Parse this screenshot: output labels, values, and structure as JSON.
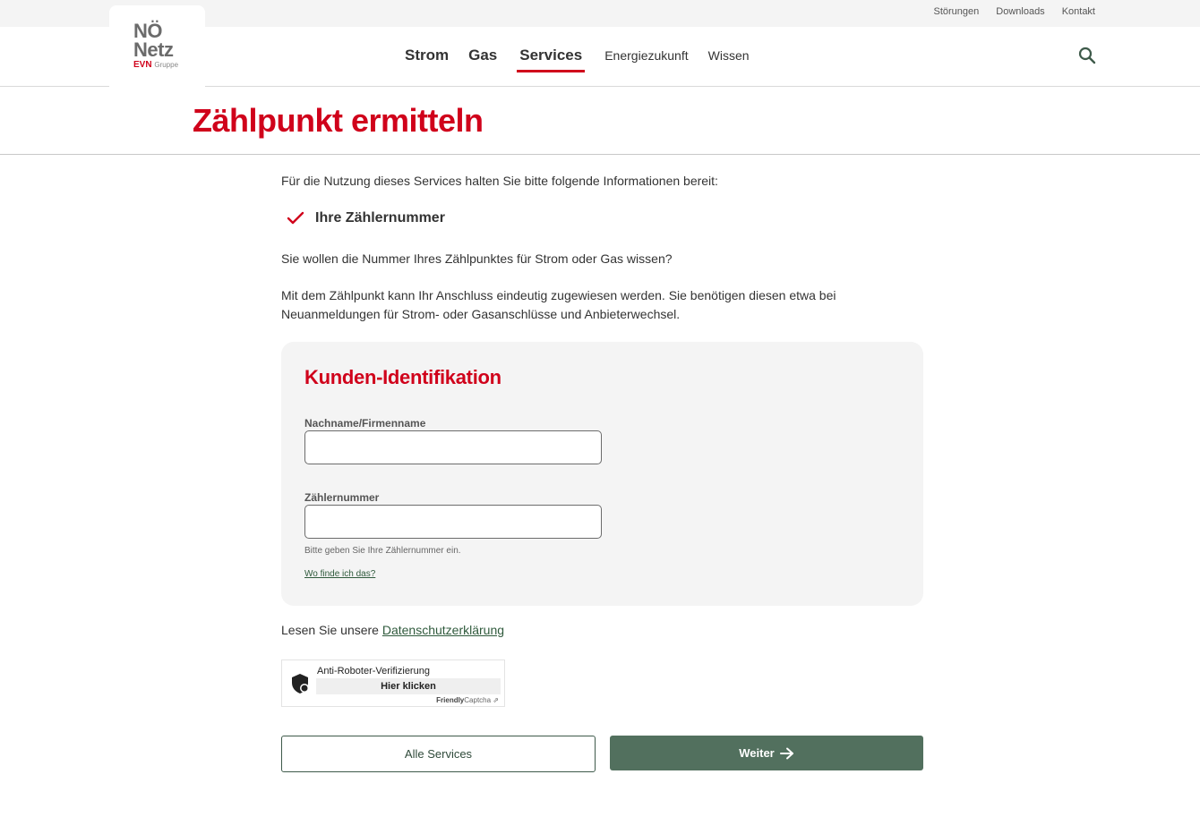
{
  "utility_links": [
    "Störungen",
    "Downloads",
    "Kontakt"
  ],
  "logo": {
    "line1": "NÖ",
    "line2": "Netz",
    "evn": "EVN",
    "gruppe": "Gruppe"
  },
  "nav": {
    "main": [
      "Strom",
      "Gas",
      "Services"
    ],
    "active": "Services",
    "sub": [
      "Energiezukunft",
      "Wissen"
    ]
  },
  "page_title": "Zählpunkt ermitteln",
  "intro": "Für die Nutzung dieses Services halten Sie bitte folgende Informationen bereit:",
  "requirement": "Ihre Zählernummer",
  "question": "Sie wollen die Nummer Ihres Zählpunktes für Strom oder Gas wissen?",
  "description": "Mit dem Zählpunkt kann Ihr Anschluss eindeutig zugewiesen werden. Sie benötigen diesen etwa bei Neuanmeldungen für Strom- oder Gasanschlüsse und Anbieterwechsel.",
  "form": {
    "title": "Kunden-Identifikation",
    "name_label": "Nachname/Firmenname",
    "name_value": "",
    "meter_label": "Zählernummer",
    "meter_value": "",
    "meter_hint": "Bitte geben Sie Ihre Zählernummer ein.",
    "help_link": "Wo finde ich das?"
  },
  "privacy": {
    "prefix": "Lesen Sie unsere",
    "link": "Datenschutzerklärung"
  },
  "captcha": {
    "title": "Anti-Roboter-Verifizierung",
    "button": "Hier klicken",
    "brand_bold": "Friendly",
    "brand_rest": "Captcha"
  },
  "buttons": {
    "back": "Alle Services",
    "next": "Weiter"
  },
  "colors": {
    "brand_red": "#d0021b",
    "primary_green": "#52705e",
    "link_green": "#2f5a3c"
  }
}
